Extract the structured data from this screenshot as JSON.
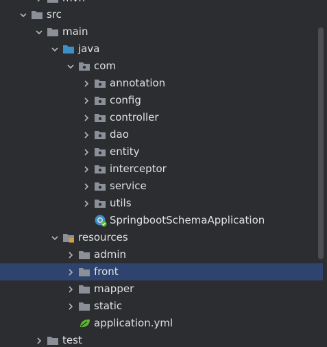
{
  "tree": {
    "items": [
      {
        "label": "mvn",
        "icon": "folder-icon",
        "expanded": false
      },
      {
        "label": "src",
        "icon": "folder-icon",
        "expanded": true
      },
      {
        "label": "main",
        "icon": "folder-icon",
        "expanded": true
      },
      {
        "label": "java",
        "icon": "source-root-folder-icon",
        "expanded": true
      },
      {
        "label": "com",
        "icon": "package-icon",
        "expanded": true
      },
      {
        "label": "annotation",
        "icon": "package-icon",
        "expanded": false
      },
      {
        "label": "config",
        "icon": "package-icon",
        "expanded": false
      },
      {
        "label": "controller",
        "icon": "package-icon",
        "expanded": false
      },
      {
        "label": "dao",
        "icon": "package-icon",
        "expanded": false
      },
      {
        "label": "entity",
        "icon": "package-icon",
        "expanded": false
      },
      {
        "label": "interceptor",
        "icon": "package-icon",
        "expanded": false
      },
      {
        "label": "service",
        "icon": "package-icon",
        "expanded": false
      },
      {
        "label": "utils",
        "icon": "package-icon",
        "expanded": false
      },
      {
        "label": "SpringbootSchemaApplication",
        "icon": "spring-boot-class-icon"
      },
      {
        "label": "resources",
        "icon": "resources-root-folder-icon",
        "expanded": true
      },
      {
        "label": "admin",
        "icon": "folder-icon",
        "expanded": false
      },
      {
        "label": "front",
        "icon": "folder-icon",
        "expanded": false,
        "selected": true
      },
      {
        "label": "mapper",
        "icon": "folder-icon",
        "expanded": false
      },
      {
        "label": "static",
        "icon": "folder-icon",
        "expanded": false
      },
      {
        "label": "application.yml",
        "icon": "spring-yml-file-icon"
      },
      {
        "label": "test",
        "icon": "folder-icon",
        "expanded": false
      }
    ]
  },
  "colors": {
    "background": "#2b2d30",
    "selection": "#2e436e",
    "folder": "#8a8f98",
    "source_root": "#3d8fc7",
    "spring": "#5fb832",
    "text": "#dfe1e5"
  }
}
